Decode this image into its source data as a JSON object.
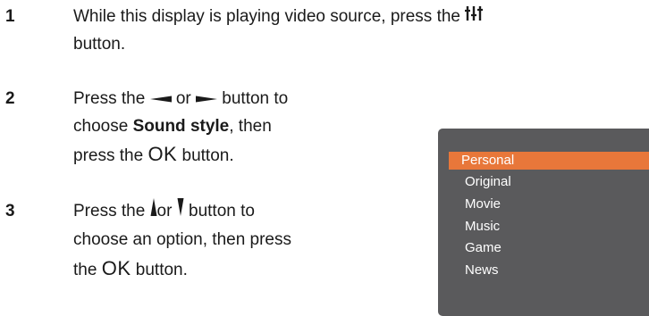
{
  "steps": [
    {
      "number": "1",
      "line1": "While this display is playing video source, press the",
      "line2": "button.",
      "icon": "settings-sliders-icon"
    },
    {
      "number": "2",
      "line1_pre": "Press the",
      "line1_mid": "or",
      "line1_post": "button to",
      "line2_pre": "choose",
      "line2_bold": "Sound style",
      "line2_post": ", then",
      "line3_pre": "press the",
      "line3_ok": "OK",
      "line3_post": "button.",
      "icons": [
        "left-arrow-icon",
        "right-arrow-icon"
      ]
    },
    {
      "number": "3",
      "line1_pre": "Press the",
      "line1_mid": "or",
      "line1_post": "button to",
      "line2": "choose an option, then press",
      "line3_pre": "the",
      "line3_ok": "OK",
      "line3_post": "button.",
      "icons": [
        "up-arrow-icon",
        "down-arrow-icon"
      ]
    }
  ],
  "menu": {
    "items": [
      "Personal",
      "Original",
      "Movie",
      "Music",
      "Game",
      "News"
    ],
    "selected": "Personal",
    "panel_color": "#5a5a5c",
    "highlight_color": "#e8773a"
  }
}
